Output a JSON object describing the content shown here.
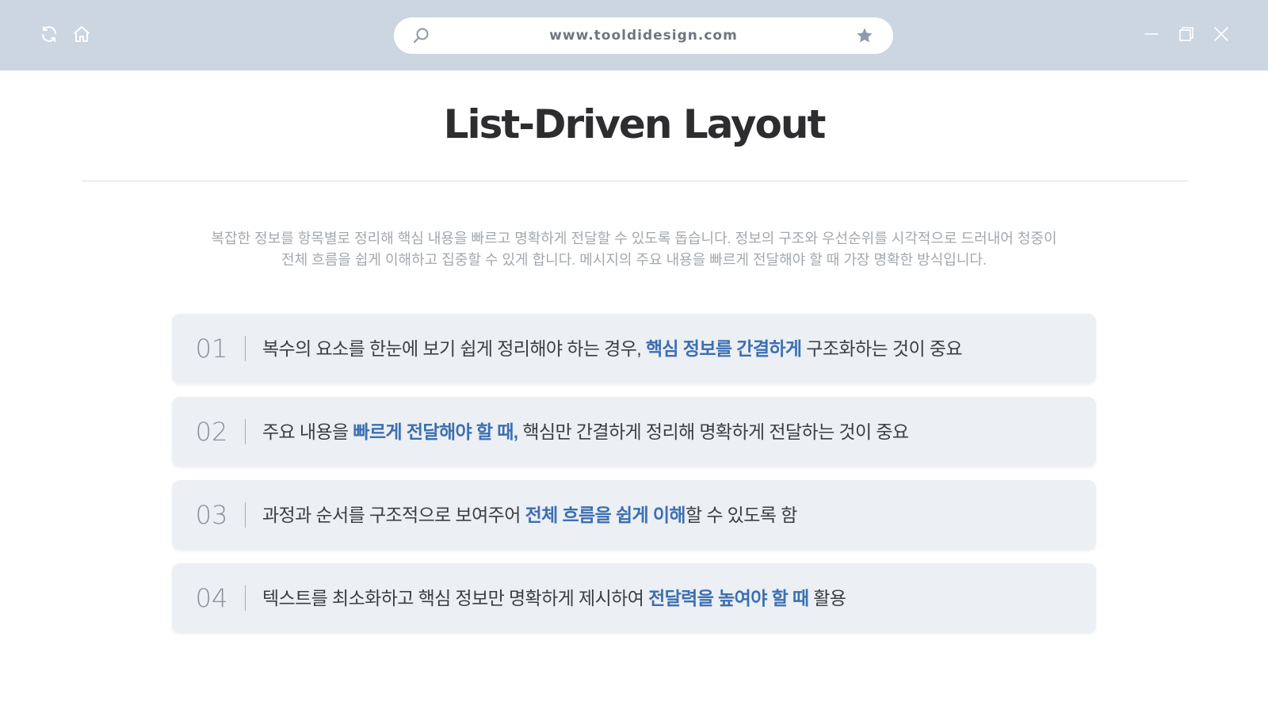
{
  "browser": {
    "url": "www.tooldidesign.com",
    "icons": [
      "refresh-icon",
      "home-icon",
      "search-icon",
      "star-icon",
      "minimize-icon",
      "restore-icon",
      "close-icon"
    ]
  },
  "page": {
    "title": "List-Driven Layout",
    "intro_line1": "복잡한 정보를 항목별로 정리해 핵심 내용을 빠르고 명확하게 전달할 수 있도록 돕습니다. 정보의 구조와 우선순위를 시각적으로 드러내어 청중이",
    "intro_line2": "전체 흐름을 쉽게 이해하고 집중할 수 있게 합니다. 메시지의 주요 내용을 빠르게 전달해야 할 때 가장 명확한 방식입니다."
  },
  "items": [
    {
      "number": "01",
      "before": "복수의 요소를 한눈에 보기 쉽게 정리해야 하는 경우, ",
      "highlight": "핵심 정보를 간결하게",
      "after": " 구조화하는 것이 중요"
    },
    {
      "number": "02",
      "before": "주요 내용을 ",
      "highlight": "빠르게 전달해야 할 때,",
      "after": " 핵심만 간결하게 정리해 명확하게 전달하는 것이 중요"
    },
    {
      "number": "03",
      "before": "과정과 순서를 구조적으로 보여주어 ",
      "highlight": "전체 흐름을 쉽게 이해",
      "after": "할 수 있도록 함"
    },
    {
      "number": "04",
      "before": "텍스트를 최소화하고 핵심 정보만 명확하게 제시하여 ",
      "highlight": "전달력을 높여야 할 때",
      "after": " 활용"
    }
  ],
  "colors": {
    "browser_bar": "#ccd6e1",
    "highlight": "#3c6fb1",
    "item_background": "#eceff3",
    "title": "#2d2d30",
    "intro_text": "#a3a8ae"
  }
}
